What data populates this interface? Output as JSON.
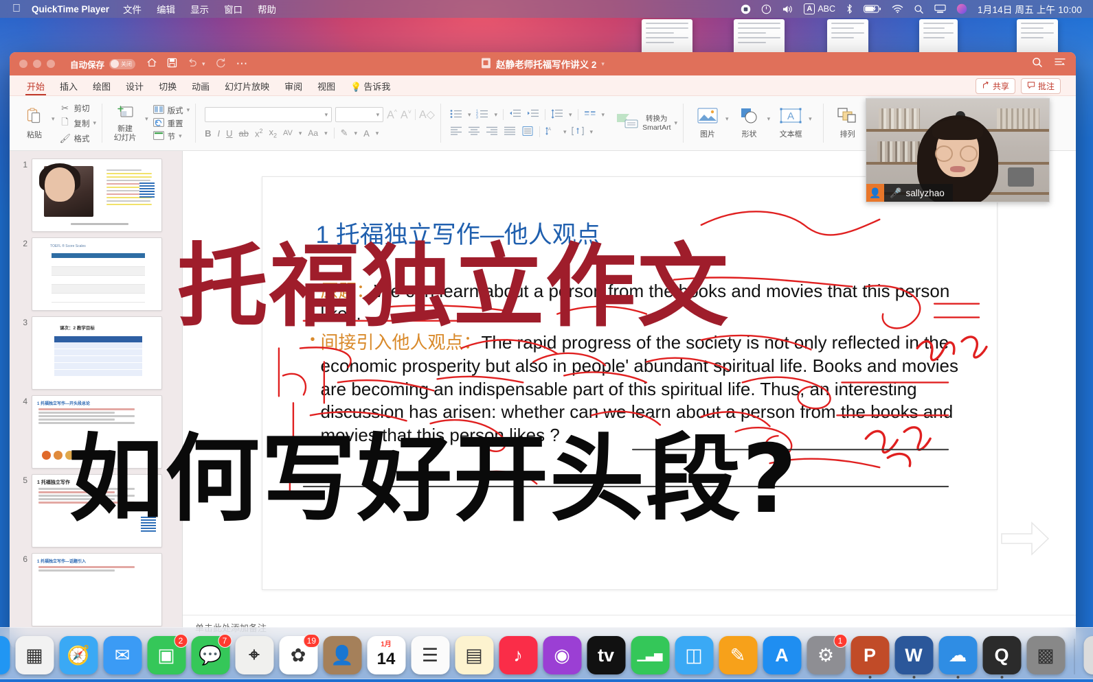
{
  "menubar": {
    "apple_icon": "apple-icon",
    "app_name": "QuickTime Player",
    "items": [
      "文件",
      "编辑",
      "显示",
      "窗口",
      "帮助"
    ],
    "status_icons": [
      "screen-record-icon",
      "control-center-icon",
      "volume-icon",
      "input-source-icon",
      "bluetooth-icon",
      "battery-icon",
      "wifi-icon",
      "spotlight-search-icon",
      "screen-mirroring-icon",
      "siri-icon"
    ],
    "input_source": "ABC",
    "clock": "1月14日 周五 上午 10:00"
  },
  "window": {
    "traffic_lights": [
      "close-button",
      "minimize-button",
      "zoom-button"
    ],
    "autosave_label": "自动保存",
    "autosave_state": "关闭",
    "quick_icons": [
      "home-icon",
      "save-icon",
      "undo-icon",
      "redo-icon",
      "more-icon"
    ],
    "doc_title": "赵静老师托福写作讲义 2",
    "right_icons": [
      "search-icon",
      "ribbon-collapse-icon"
    ],
    "accent_color": "#e0705a"
  },
  "ribbon": {
    "tabs": [
      {
        "label": "开始",
        "active": true
      },
      {
        "label": "插入",
        "active": false
      },
      {
        "label": "绘图",
        "active": false
      },
      {
        "label": "设计",
        "active": false
      },
      {
        "label": "切换",
        "active": false
      },
      {
        "label": "动画",
        "active": false
      },
      {
        "label": "幻灯片放映",
        "active": false
      },
      {
        "label": "审阅",
        "active": false
      },
      {
        "label": "视图",
        "active": false
      }
    ],
    "tell_me": "告诉我",
    "share_label": "共享",
    "comment_label": "批注",
    "clipboard": {
      "paste": "粘贴",
      "cut": "剪切",
      "copy": "复制",
      "format": "格式"
    },
    "slides": {
      "new_slide_line1": "新建",
      "new_slide_line2": "幻灯片",
      "layout": "版式",
      "reset": "重置",
      "section": "节"
    },
    "font": {
      "font_name": "",
      "font_size": "",
      "grow": "A",
      "shrink": "A",
      "clear_format": "clear-formatting-icon",
      "bold": "B",
      "italic": "I",
      "underline": "U",
      "strike": "ab",
      "superscript": "x",
      "subscript": "x",
      "spacing": "AV",
      "case": "Aa",
      "highlight": "highlighter-icon",
      "color": "A"
    },
    "paragraph": {
      "bullets": "bulleted-list-icon",
      "numbering": "numbered-list-icon",
      "decrease_indent": "decrease-indent-icon",
      "increase_indent": "increase-indent-icon",
      "line_spacing": "line-spacing-icon",
      "columns": "columns-icon",
      "smartart_line1": "转换为",
      "smartart_line2": "SmartArt",
      "align_left": "align-left-icon",
      "align_center": "align-center-icon",
      "align_right": "align-right-icon",
      "justify": "justify-icon",
      "text_direction": "text-direction-icon",
      "align_text": "align-text-icon"
    },
    "insert": {
      "picture": "图片",
      "shape": "形状",
      "textbox": "文本框",
      "arrange": "排列"
    }
  },
  "thumbnails": {
    "slides": [
      {
        "number": "1",
        "kind": "photo-intro"
      },
      {
        "number": "2",
        "kind": "score-table",
        "heading": "TOEFL ® Score Scales"
      },
      {
        "number": "3",
        "kind": "agenda",
        "heading": "课次：2    教学目标"
      },
      {
        "number": "4",
        "kind": "outline",
        "heading": "1 托福独立写作—开头段总论"
      },
      {
        "number": "5",
        "kind": "notes",
        "heading": "1 托福独立写作"
      },
      {
        "number": "6",
        "kind": "topic",
        "heading": "1 托福独立写作—话题引入"
      }
    ]
  },
  "slide": {
    "title": "1 托福独立写作—他人观点",
    "bullets": [
      {
        "zh": "原题：",
        "en": "We can learn about a person from the books and movies that this person likes."
      },
      {
        "zh": "间接引入他人观点：",
        "en": "The rapid progress of the society is not only reflected in the economic prosperity but also in people' abundant spiritual life. Books and movies are becoming an indispensable part of this spiritual life. Thus, an interesting discussion has arisen: whether can we learn about a person from the books and movies that this person likes ?"
      }
    ],
    "notes_placeholder": "单击此处添加备注",
    "next_arrow": "next-slide-arrow"
  },
  "overlay": {
    "red_text": "托福独立作文",
    "red_color": "#9f1d2b",
    "black_text": "如何写好开头段?",
    "black_color": "#0a0a0a"
  },
  "video": {
    "participant_name": "sallyzhao",
    "avatar_icon": "person-avatar-icon",
    "mic_icon": "microphone-icon"
  },
  "dock": {
    "items": [
      {
        "name": "finder",
        "glyph": "☺",
        "color": "#2196f3",
        "badge": null,
        "running": true
      },
      {
        "name": "launchpad",
        "glyph": "▦",
        "color": "#f2f2f2",
        "badge": null,
        "running": false
      },
      {
        "name": "safari",
        "glyph": "🧭",
        "color": "#3aa9f5",
        "badge": null,
        "running": false
      },
      {
        "name": "mail",
        "glyph": "✉",
        "color": "#3b9bf5",
        "badge": null,
        "running": false
      },
      {
        "name": "facetime",
        "glyph": "▣",
        "color": "#35c759",
        "badge": "2",
        "running": false
      },
      {
        "name": "messages",
        "glyph": "💬",
        "color": "#35c759",
        "badge": "7",
        "running": false
      },
      {
        "name": "maps",
        "glyph": "⌖",
        "color": "#f0f0ee",
        "badge": null,
        "running": false
      },
      {
        "name": "photos",
        "glyph": "✿",
        "color": "#ffffff",
        "badge": "19",
        "running": false
      },
      {
        "name": "contacts",
        "glyph": "👤",
        "color": "#a5805a",
        "badge": null,
        "running": false
      },
      {
        "name": "calendar",
        "glyph": "14",
        "color": "#ffffff",
        "badge": null,
        "running": false,
        "sub": "1月"
      },
      {
        "name": "reminders",
        "glyph": "☰",
        "color": "#fbfbfb",
        "badge": null,
        "running": false
      },
      {
        "name": "notes",
        "glyph": "▤",
        "color": "#fdf3cf",
        "badge": null,
        "running": false
      },
      {
        "name": "music",
        "glyph": "♪",
        "color": "#fa2d48",
        "badge": null,
        "running": false
      },
      {
        "name": "podcasts",
        "glyph": "◉",
        "color": "#9b3fd4",
        "badge": null,
        "running": false
      },
      {
        "name": "apple-tv",
        "glyph": "tv",
        "color": "#111111",
        "badge": null,
        "running": false
      },
      {
        "name": "numbers",
        "glyph": "▁▃▅",
        "color": "#34c759",
        "badge": null,
        "running": false
      },
      {
        "name": "keynote",
        "glyph": "◫",
        "color": "#3aa9f5",
        "badge": null,
        "running": false
      },
      {
        "name": "pages",
        "glyph": "✎",
        "color": "#f7a11a",
        "badge": null,
        "running": false
      },
      {
        "name": "app-store",
        "glyph": "A",
        "color": "#1f8ef1",
        "badge": null,
        "running": false
      },
      {
        "name": "system-preferences",
        "glyph": "⚙",
        "color": "#8e8e93",
        "badge": "1",
        "running": false
      },
      {
        "name": "powerpoint",
        "glyph": "P",
        "color": "#c14b28",
        "badge": null,
        "running": true
      },
      {
        "name": "word",
        "glyph": "W",
        "color": "#2b579a",
        "badge": null,
        "running": true
      },
      {
        "name": "onedrive",
        "glyph": "☁",
        "color": "#2f8de4",
        "badge": null,
        "running": true
      },
      {
        "name": "quicktime-player",
        "glyph": "Q",
        "color": "#2b2b2b",
        "badge": null,
        "running": true
      },
      {
        "name": "screenshot-preview",
        "glyph": "▩",
        "color": "#888888",
        "badge": null,
        "running": false
      },
      {
        "name": "trash",
        "glyph": "🗑",
        "color": "#dcdcdc",
        "badge": null,
        "running": false
      }
    ]
  }
}
